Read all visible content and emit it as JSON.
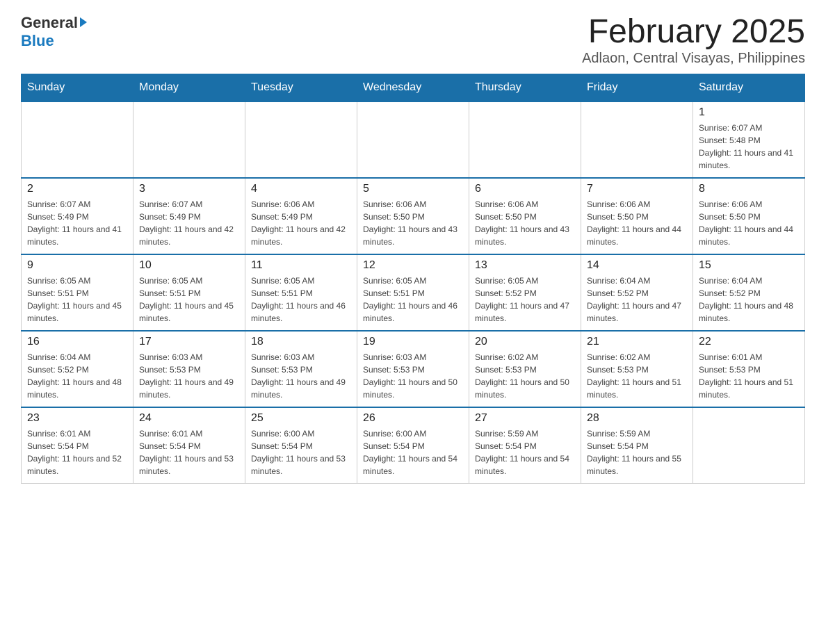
{
  "header": {
    "logo_general": "General",
    "logo_blue": "Blue",
    "month_title": "February 2025",
    "location": "Adlaon, Central Visayas, Philippines"
  },
  "days_of_week": [
    "Sunday",
    "Monday",
    "Tuesday",
    "Wednesday",
    "Thursday",
    "Friday",
    "Saturday"
  ],
  "weeks": [
    [
      {
        "day": "",
        "sunrise": "",
        "sunset": "",
        "daylight": "",
        "empty": true
      },
      {
        "day": "",
        "sunrise": "",
        "sunset": "",
        "daylight": "",
        "empty": true
      },
      {
        "day": "",
        "sunrise": "",
        "sunset": "",
        "daylight": "",
        "empty": true
      },
      {
        "day": "",
        "sunrise": "",
        "sunset": "",
        "daylight": "",
        "empty": true
      },
      {
        "day": "",
        "sunrise": "",
        "sunset": "",
        "daylight": "",
        "empty": true
      },
      {
        "day": "",
        "sunrise": "",
        "sunset": "",
        "daylight": "",
        "empty": true
      },
      {
        "day": "1",
        "sunrise": "Sunrise: 6:07 AM",
        "sunset": "Sunset: 5:48 PM",
        "daylight": "Daylight: 11 hours and 41 minutes.",
        "empty": false
      }
    ],
    [
      {
        "day": "2",
        "sunrise": "Sunrise: 6:07 AM",
        "sunset": "Sunset: 5:49 PM",
        "daylight": "Daylight: 11 hours and 41 minutes.",
        "empty": false
      },
      {
        "day": "3",
        "sunrise": "Sunrise: 6:07 AM",
        "sunset": "Sunset: 5:49 PM",
        "daylight": "Daylight: 11 hours and 42 minutes.",
        "empty": false
      },
      {
        "day": "4",
        "sunrise": "Sunrise: 6:06 AM",
        "sunset": "Sunset: 5:49 PM",
        "daylight": "Daylight: 11 hours and 42 minutes.",
        "empty": false
      },
      {
        "day": "5",
        "sunrise": "Sunrise: 6:06 AM",
        "sunset": "Sunset: 5:50 PM",
        "daylight": "Daylight: 11 hours and 43 minutes.",
        "empty": false
      },
      {
        "day": "6",
        "sunrise": "Sunrise: 6:06 AM",
        "sunset": "Sunset: 5:50 PM",
        "daylight": "Daylight: 11 hours and 43 minutes.",
        "empty": false
      },
      {
        "day": "7",
        "sunrise": "Sunrise: 6:06 AM",
        "sunset": "Sunset: 5:50 PM",
        "daylight": "Daylight: 11 hours and 44 minutes.",
        "empty": false
      },
      {
        "day": "8",
        "sunrise": "Sunrise: 6:06 AM",
        "sunset": "Sunset: 5:50 PM",
        "daylight": "Daylight: 11 hours and 44 minutes.",
        "empty": false
      }
    ],
    [
      {
        "day": "9",
        "sunrise": "Sunrise: 6:05 AM",
        "sunset": "Sunset: 5:51 PM",
        "daylight": "Daylight: 11 hours and 45 minutes.",
        "empty": false
      },
      {
        "day": "10",
        "sunrise": "Sunrise: 6:05 AM",
        "sunset": "Sunset: 5:51 PM",
        "daylight": "Daylight: 11 hours and 45 minutes.",
        "empty": false
      },
      {
        "day": "11",
        "sunrise": "Sunrise: 6:05 AM",
        "sunset": "Sunset: 5:51 PM",
        "daylight": "Daylight: 11 hours and 46 minutes.",
        "empty": false
      },
      {
        "day": "12",
        "sunrise": "Sunrise: 6:05 AM",
        "sunset": "Sunset: 5:51 PM",
        "daylight": "Daylight: 11 hours and 46 minutes.",
        "empty": false
      },
      {
        "day": "13",
        "sunrise": "Sunrise: 6:05 AM",
        "sunset": "Sunset: 5:52 PM",
        "daylight": "Daylight: 11 hours and 47 minutes.",
        "empty": false
      },
      {
        "day": "14",
        "sunrise": "Sunrise: 6:04 AM",
        "sunset": "Sunset: 5:52 PM",
        "daylight": "Daylight: 11 hours and 47 minutes.",
        "empty": false
      },
      {
        "day": "15",
        "sunrise": "Sunrise: 6:04 AM",
        "sunset": "Sunset: 5:52 PM",
        "daylight": "Daylight: 11 hours and 48 minutes.",
        "empty": false
      }
    ],
    [
      {
        "day": "16",
        "sunrise": "Sunrise: 6:04 AM",
        "sunset": "Sunset: 5:52 PM",
        "daylight": "Daylight: 11 hours and 48 minutes.",
        "empty": false
      },
      {
        "day": "17",
        "sunrise": "Sunrise: 6:03 AM",
        "sunset": "Sunset: 5:53 PM",
        "daylight": "Daylight: 11 hours and 49 minutes.",
        "empty": false
      },
      {
        "day": "18",
        "sunrise": "Sunrise: 6:03 AM",
        "sunset": "Sunset: 5:53 PM",
        "daylight": "Daylight: 11 hours and 49 minutes.",
        "empty": false
      },
      {
        "day": "19",
        "sunrise": "Sunrise: 6:03 AM",
        "sunset": "Sunset: 5:53 PM",
        "daylight": "Daylight: 11 hours and 50 minutes.",
        "empty": false
      },
      {
        "day": "20",
        "sunrise": "Sunrise: 6:02 AM",
        "sunset": "Sunset: 5:53 PM",
        "daylight": "Daylight: 11 hours and 50 minutes.",
        "empty": false
      },
      {
        "day": "21",
        "sunrise": "Sunrise: 6:02 AM",
        "sunset": "Sunset: 5:53 PM",
        "daylight": "Daylight: 11 hours and 51 minutes.",
        "empty": false
      },
      {
        "day": "22",
        "sunrise": "Sunrise: 6:01 AM",
        "sunset": "Sunset: 5:53 PM",
        "daylight": "Daylight: 11 hours and 51 minutes.",
        "empty": false
      }
    ],
    [
      {
        "day": "23",
        "sunrise": "Sunrise: 6:01 AM",
        "sunset": "Sunset: 5:54 PM",
        "daylight": "Daylight: 11 hours and 52 minutes.",
        "empty": false
      },
      {
        "day": "24",
        "sunrise": "Sunrise: 6:01 AM",
        "sunset": "Sunset: 5:54 PM",
        "daylight": "Daylight: 11 hours and 53 minutes.",
        "empty": false
      },
      {
        "day": "25",
        "sunrise": "Sunrise: 6:00 AM",
        "sunset": "Sunset: 5:54 PM",
        "daylight": "Daylight: 11 hours and 53 minutes.",
        "empty": false
      },
      {
        "day": "26",
        "sunrise": "Sunrise: 6:00 AM",
        "sunset": "Sunset: 5:54 PM",
        "daylight": "Daylight: 11 hours and 54 minutes.",
        "empty": false
      },
      {
        "day": "27",
        "sunrise": "Sunrise: 5:59 AM",
        "sunset": "Sunset: 5:54 PM",
        "daylight": "Daylight: 11 hours and 54 minutes.",
        "empty": false
      },
      {
        "day": "28",
        "sunrise": "Sunrise: 5:59 AM",
        "sunset": "Sunset: 5:54 PM",
        "daylight": "Daylight: 11 hours and 55 minutes.",
        "empty": false
      },
      {
        "day": "",
        "sunrise": "",
        "sunset": "",
        "daylight": "",
        "empty": true
      }
    ]
  ]
}
